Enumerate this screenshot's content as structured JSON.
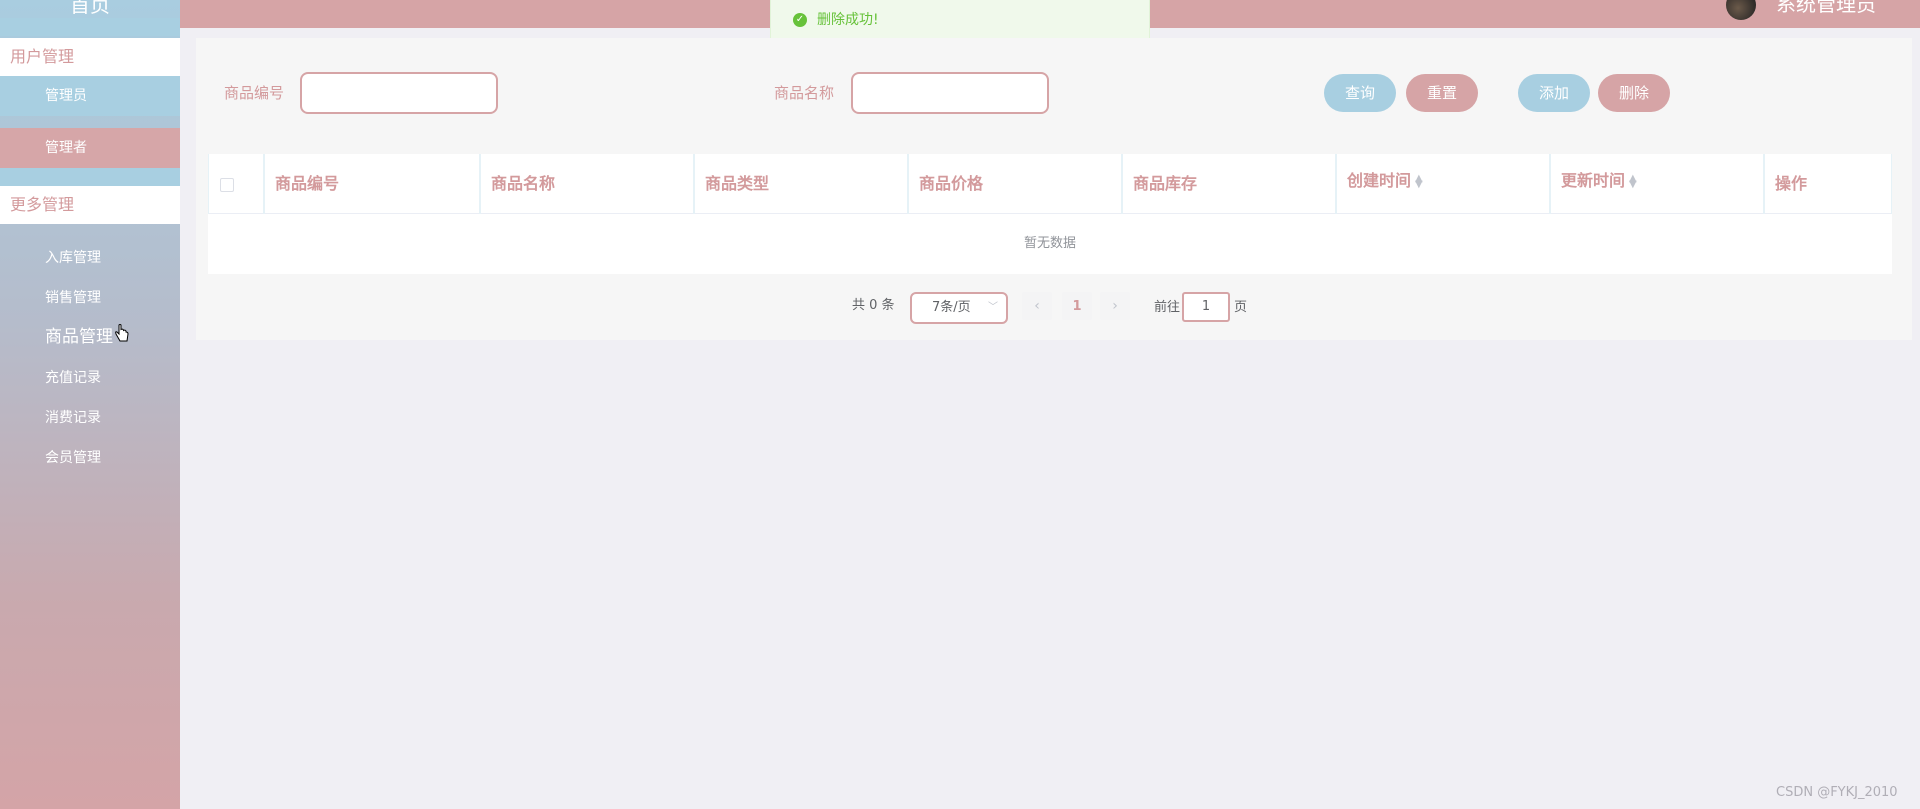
{
  "sidebar": {
    "home": "首页",
    "groups": [
      {
        "label": "用户管理"
      },
      {
        "label": "更多管理"
      }
    ],
    "admin_items": [
      "管理员",
      "管理者"
    ],
    "more_items": [
      "入库管理",
      "销售管理",
      "商品管理",
      "充值记录",
      "消费记录",
      "会员管理"
    ]
  },
  "header": {
    "admin_name": "系统管理员"
  },
  "toast": {
    "message": "删除成功!"
  },
  "search": {
    "code_label": "商品编号",
    "code_value": "",
    "name_label": "商品名称",
    "name_value": "",
    "query_button": "查询",
    "reset_button": "重置",
    "add_button": "添加",
    "delete_button": "删除"
  },
  "table": {
    "columns": [
      "商品编号",
      "商品名称",
      "商品类型",
      "商品价格",
      "商品库存",
      "创建时间",
      "更新时间",
      "操作"
    ],
    "empty_text": "暂无数据"
  },
  "pagination": {
    "total": "共 0 条",
    "page_size": "7条/页",
    "current_page": "1",
    "goto_label": "前往",
    "goto_value": "1",
    "page_suffix": "页"
  },
  "watermark": "CSDN @FYKJ_2010",
  "colors": {
    "accent_pink": "#d6a4a6",
    "accent_blue": "#a8cfe1",
    "success": "#67c23a"
  }
}
